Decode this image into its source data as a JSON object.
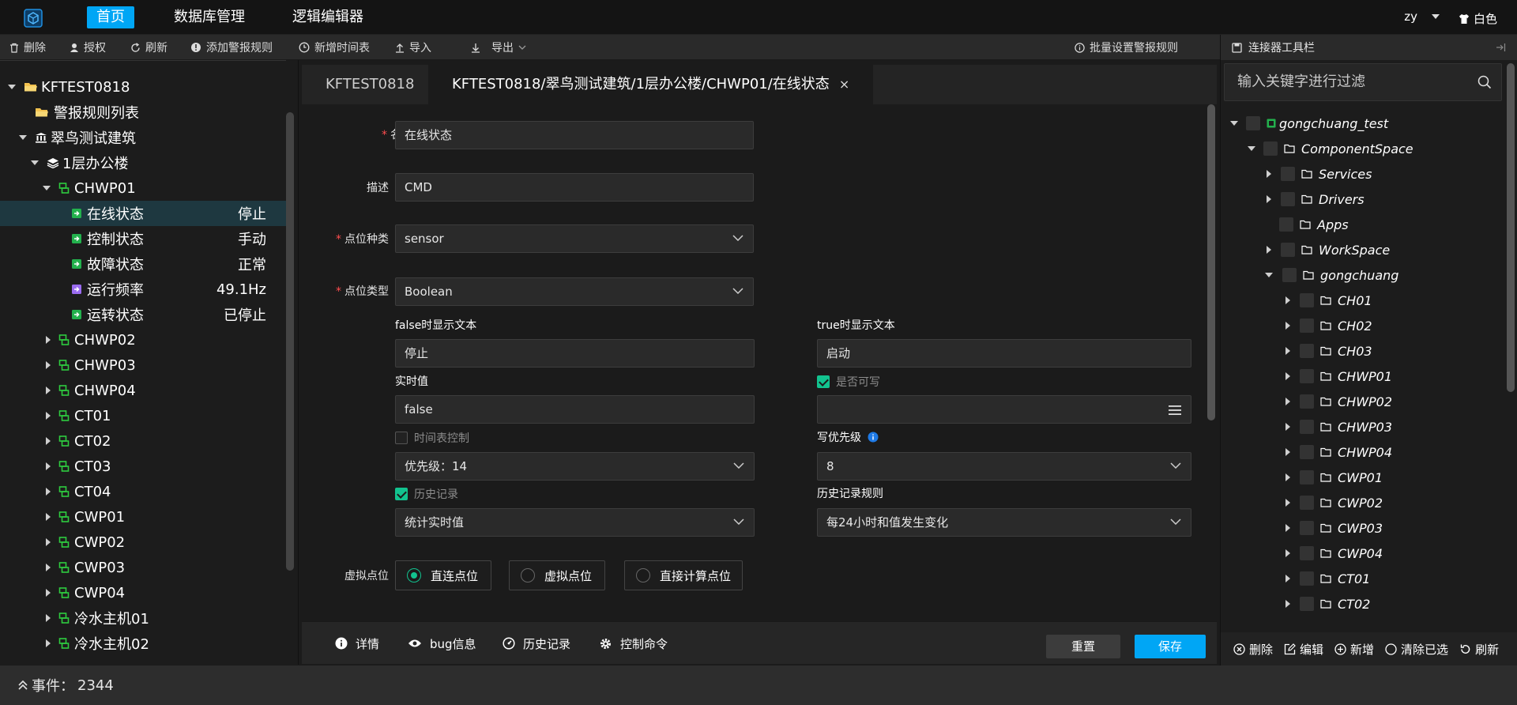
{
  "nav": {
    "items": [
      "首页",
      "数据库管理",
      "逻辑编辑器"
    ],
    "user": "zy",
    "theme": "白色"
  },
  "toolbar": {
    "delete": "删除",
    "grant": "授权",
    "refresh": "刷新",
    "add_alarm": "添加警报规则",
    "add_schedule": "新增时间表",
    "import": "导入",
    "export": "导出",
    "batch_alarm": "批量设置警报规则"
  },
  "left_tree": {
    "root": "KFTEST0818",
    "alarm_list": "警报规则列表",
    "building": "翠鸟测试建筑",
    "floor": "1层办公楼",
    "device": "CHWP01",
    "points": [
      {
        "label": "在线状态",
        "value": "停止"
      },
      {
        "label": "控制状态",
        "value": "手动"
      },
      {
        "label": "故障状态",
        "value": "正常"
      },
      {
        "label": "运行频率",
        "value": "49.1Hz"
      },
      {
        "label": "运转状态",
        "value": "已停止"
      }
    ],
    "devices": [
      "CHWP02",
      "CHWP03",
      "CHWP04",
      "CT01",
      "CT02",
      "CT03",
      "CT04",
      "CWP01",
      "CWP02",
      "CWP03",
      "CWP04",
      "冷水主机01",
      "冷水主机02"
    ]
  },
  "tabs": {
    "tab1": "KFTEST0818",
    "tab2": "KFTEST0818/翠鸟测试建筑/1层办公楼/CHWP01/在线状态",
    "close": "×"
  },
  "form": {
    "req_mark": "*",
    "name_label": "名称",
    "name_value": "在线状态",
    "desc_label": "描述",
    "desc_value": "CMD",
    "kind_label": "点位种类",
    "kind_value": "sensor",
    "type_label": "点位类型",
    "type_value": "Boolean",
    "false_text_label": "false时显示文本",
    "false_text_value": "停止",
    "true_text_label": "true时显示文本",
    "true_text_value": "启动",
    "realtime_label": "实时值",
    "realtime_value": "false",
    "writable_label": "是否可写",
    "schedule_label": "时间表控制",
    "priority_value": "优先级：14",
    "write_priority_label": "写优先级",
    "write_priority_value": "8",
    "history_label": "历史记录",
    "history_rule_label": "历史记录规则",
    "history_mode_value": "统计实时值",
    "history_rule_value": "每24小时和值发生变化",
    "virtual_label": "虚拟点位",
    "radio_options": [
      "直连点位",
      "虚拟点位",
      "直接计算点位"
    ]
  },
  "form_bar": {
    "detail": "详情",
    "bug": "bug信息",
    "history": "历史记录",
    "command": "控制命令",
    "reset": "重置",
    "save": "保存"
  },
  "right_panel": {
    "title": "连接器工具栏",
    "filter_placeholder": "输入关键字进行过滤",
    "root": "gongchuang_test",
    "space": "ComponentSpace",
    "space_children": [
      "Services",
      "Drivers",
      "Apps",
      "WorkSpace"
    ],
    "gongchuang": "gongchuang",
    "items": [
      "CH01",
      "CH02",
      "CH03",
      "CHWP01",
      "CHWP02",
      "CHWP03",
      "CHWP04",
      "CWP01",
      "CWP02",
      "CWP03",
      "CWP04",
      "CT01",
      "CT02"
    ],
    "footer": {
      "delete": "删除",
      "edit": "编辑",
      "add": "新增",
      "clear": "清除已选",
      "refresh": "刷新"
    }
  },
  "status": {
    "label": "事件：",
    "count": "2344"
  },
  "colors": {
    "accent": "#00a6f5",
    "green": "#12c38f",
    "device_icon": "#2ecc40",
    "required": "#ff4d4f"
  }
}
